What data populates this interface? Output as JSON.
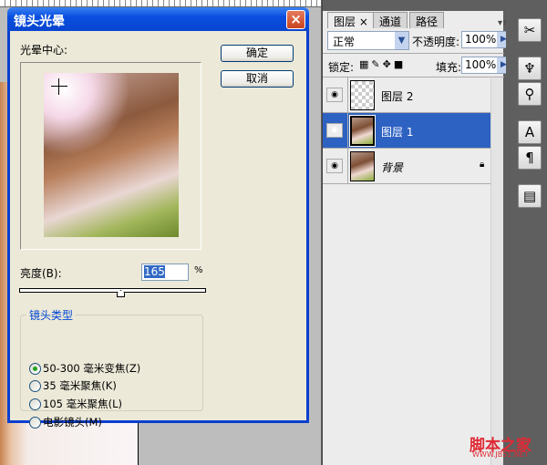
{
  "dialog": {
    "title": "镜头光晕",
    "close_icon": "×",
    "center_label": "光晕中心:",
    "ok_label": "确定",
    "cancel_label": "取消",
    "brightness_label": "亮度(B):",
    "brightness_value": "165",
    "brightness_unit": "%",
    "brightness_percent": 165,
    "lens_group_label": "镜头类型",
    "lens_options": [
      {
        "label": "50-300 毫米变焦(Z)",
        "selected": true
      },
      {
        "label": "35 毫米聚焦(K)",
        "selected": false
      },
      {
        "label": "105 毫米聚焦(L)",
        "selected": false
      },
      {
        "label": "电影镜头(M)",
        "selected": false
      }
    ]
  },
  "layers_panel": {
    "tabs": [
      "图层 ×",
      "通道",
      "路径"
    ],
    "blend_mode": "正常",
    "opacity_label": "不透明度:",
    "opacity_value": "100%",
    "lock_label": "锁定:",
    "fill_label": "填充:",
    "fill_value": "100%",
    "layers": [
      {
        "name": "图层 2",
        "selected": false,
        "locked": false
      },
      {
        "name": "图层 1",
        "selected": true,
        "locked": false
      },
      {
        "name": "背景",
        "selected": false,
        "locked": true
      }
    ]
  },
  "watermark": {
    "text": "脚本之家",
    "url": "WWW.JB51.NET"
  },
  "colors": {
    "titlebar": "#0a4ee0",
    "selection": "#2d61c2",
    "dialog_bg": "#ece9d8"
  }
}
